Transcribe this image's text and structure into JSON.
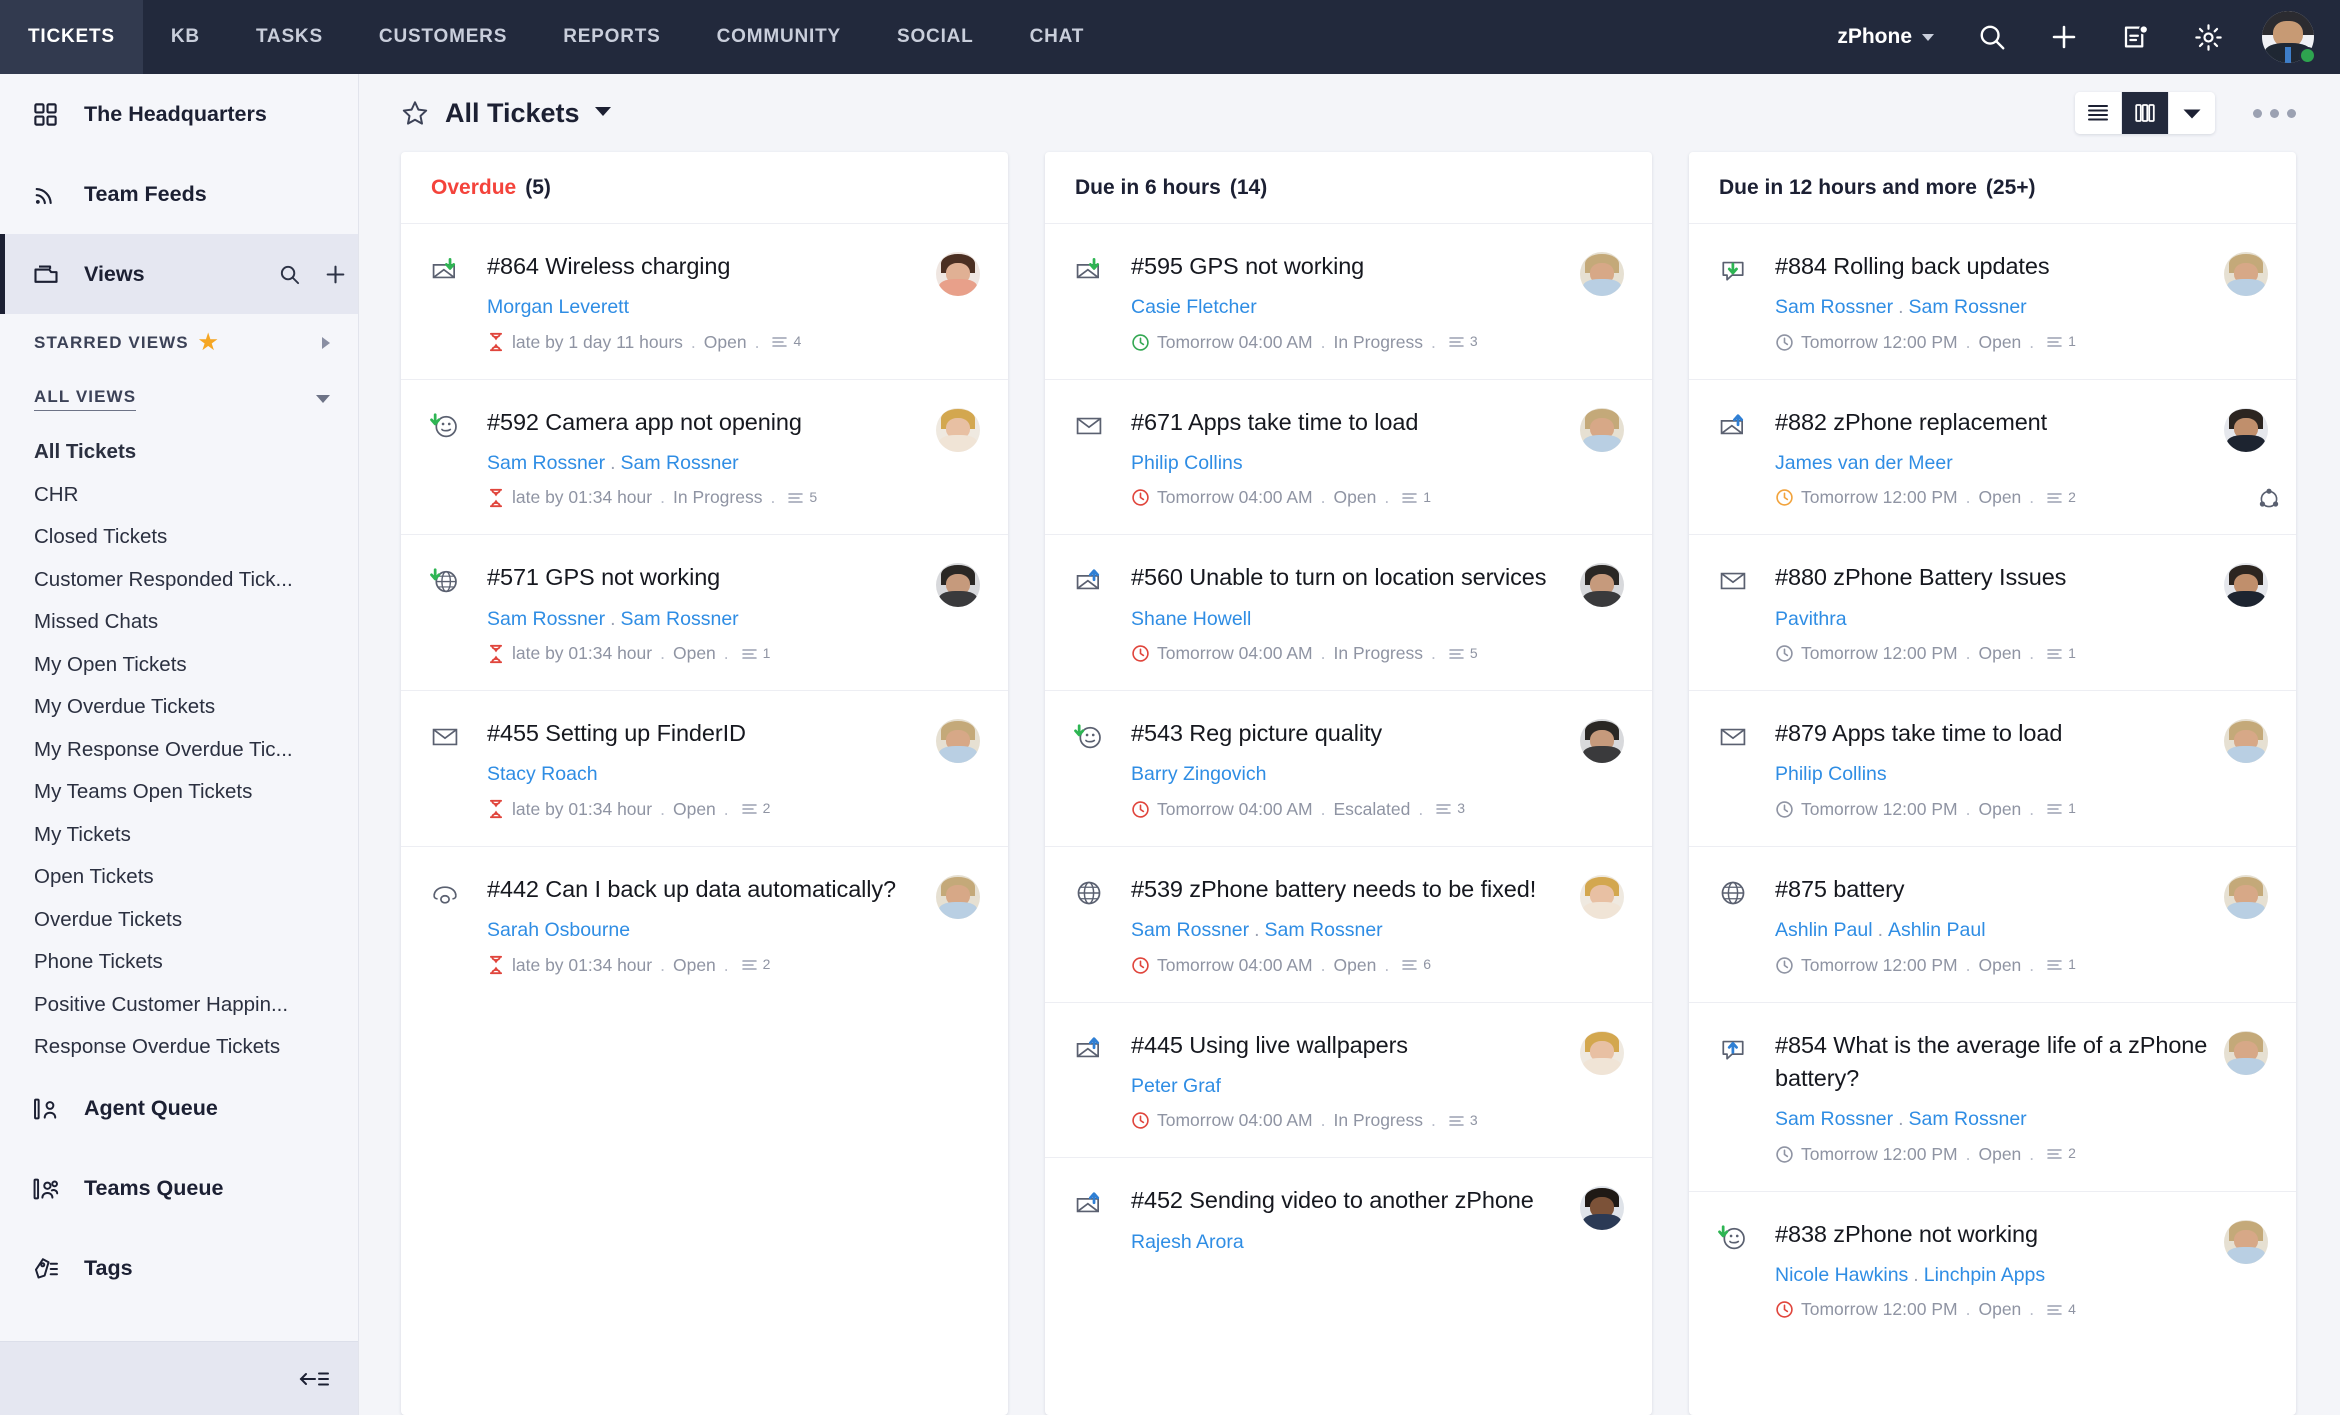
{
  "topnav": {
    "tabs": [
      {
        "label": "TICKETS",
        "active": true
      },
      {
        "label": "KB",
        "active": false
      },
      {
        "label": "TASKS",
        "active": false
      },
      {
        "label": "CUSTOMERS",
        "active": false
      },
      {
        "label": "REPORTS",
        "active": false
      },
      {
        "label": "COMMUNITY",
        "active": false
      },
      {
        "label": "SOCIAL",
        "active": false
      },
      {
        "label": "CHAT",
        "active": false
      }
    ],
    "product": "zPhone",
    "icons": [
      "search-icon",
      "add-icon",
      "notes-icon",
      "gear-icon"
    ],
    "background": "#22293c",
    "active_tab_background": "#323a4f"
  },
  "sidebar": {
    "top_items": [
      {
        "label": "The Headquarters",
        "icon": "grid-icon"
      },
      {
        "label": "Team Feeds",
        "icon": "rss-icon"
      },
      {
        "label": "Views",
        "icon": "views-folder-icon",
        "selected": true
      }
    ],
    "starred_group": "STARRED VIEWS",
    "all_group": "ALL VIEWS",
    "views": [
      {
        "label": "All Tickets",
        "current": true
      },
      {
        "label": "CHR",
        "current": false
      },
      {
        "label": "Closed Tickets",
        "current": false
      },
      {
        "label": "Customer Responded Tick...",
        "current": false
      },
      {
        "label": "Missed Chats",
        "current": false
      },
      {
        "label": "My Open Tickets",
        "current": false
      },
      {
        "label": "My Overdue Tickets",
        "current": false
      },
      {
        "label": "My Response Overdue Tic...",
        "current": false
      },
      {
        "label": "My Teams Open Tickets",
        "current": false
      },
      {
        "label": "My Tickets",
        "current": false
      },
      {
        "label": "Open Tickets",
        "current": false
      },
      {
        "label": "Overdue Tickets",
        "current": false
      },
      {
        "label": "Phone Tickets",
        "current": false
      },
      {
        "label": "Positive Customer Happin...",
        "current": false
      },
      {
        "label": "Response Overdue Tickets",
        "current": false
      }
    ],
    "bottom_items": [
      {
        "label": "Agent Queue",
        "icon": "agent-queue-icon"
      },
      {
        "label": "Teams Queue",
        "icon": "teams-queue-icon"
      },
      {
        "label": "Tags",
        "icon": "tag-icon"
      }
    ],
    "collapse_label": "collapse-sidebar"
  },
  "toolbar": {
    "title": "All Tickets",
    "star_icon": "star-outline-icon",
    "dropdown_icon": "chevron-down-icon",
    "view_list_icon": "list-view-icon",
    "view_kanban_icon": "kanban-view-icon",
    "view_more_icon": "chevron-down-icon",
    "overflow_icon": "more-options-icon"
  },
  "board": {
    "columns": [
      {
        "title": "Overdue",
        "count": "(5)",
        "title_color": "#f4433b",
        "cards": [
          {
            "channel_icon": "email-reply-icon",
            "title": "#864 Wireless charging",
            "people": [
              "Morgan Leverett"
            ],
            "meta_icon": "hourglass-icon",
            "meta_icon_color": "#e0453c",
            "due": "late by 1 day 11 hours",
            "status": "Open",
            "threads": "4",
            "avatar": "woman-brown-hair"
          },
          {
            "channel_icon": "feedback-smiley-reply-icon",
            "title": "#592 Camera app not opening",
            "people": [
              "Sam Rossner",
              "Sam Rossner"
            ],
            "meta_icon": "hourglass-icon",
            "meta_icon_color": "#e0453c",
            "due": "late by 01:34 hour",
            "status": "In Progress",
            "threads": "5",
            "avatar": "woman-blonde"
          },
          {
            "channel_icon": "web-reply-icon",
            "title": "#571 GPS not working",
            "people": [
              "Sam Rossner",
              "Sam Rossner"
            ],
            "meta_icon": "hourglass-icon",
            "meta_icon_color": "#e0453c",
            "due": "late by 01:34 hour",
            "status": "Open",
            "threads": "1",
            "avatar": "man-dark-glasses"
          },
          {
            "channel_icon": "email-icon",
            "title": "#455 Setting up FinderID",
            "people": [
              "Stacy Roach"
            ],
            "meta_icon": "hourglass-icon",
            "meta_icon_color": "#e0453c",
            "due": "late by 01:34 hour",
            "status": "Open",
            "threads": "2",
            "avatar": "man-light-shirt"
          },
          {
            "channel_icon": "phone-icon",
            "title": "#442 Can I back up data automatically?",
            "people": [
              "Sarah Osbourne"
            ],
            "meta_icon": "hourglass-icon",
            "meta_icon_color": "#e0453c",
            "due": "late by 01:34 hour",
            "status": "Open",
            "threads": "2",
            "avatar": "man-light-shirt"
          }
        ]
      },
      {
        "title": "Due in 6 hours",
        "count": "(14)",
        "title_color": "#1c2033",
        "cards": [
          {
            "channel_icon": "email-reply-icon",
            "title": "#595 GPS not working",
            "people": [
              "Casie Fletcher"
            ],
            "meta_icon": "clock-icon",
            "meta_icon_color": "#34a853",
            "due": "Tomorrow 04:00 AM",
            "status": "In Progress",
            "threads": "3",
            "avatar": "man-light-shirt"
          },
          {
            "channel_icon": "email-icon",
            "title": "#671 Apps take time to load",
            "people": [
              "Philip Collins"
            ],
            "meta_icon": "clock-icon",
            "meta_icon_color": "#e0453c",
            "due": "Tomorrow 04:00 AM",
            "status": "Open",
            "threads": "1",
            "avatar": "man-light-shirt"
          },
          {
            "channel_icon": "email-forward-icon",
            "title": "#560 Unable to turn on location services",
            "people": [
              "Shane Howell"
            ],
            "meta_icon": "clock-icon",
            "meta_icon_color": "#e0453c",
            "due": "Tomorrow 04:00 AM",
            "status": "In Progress",
            "threads": "5",
            "avatar": "man-dark-glasses"
          },
          {
            "channel_icon": "feedback-smiley-reply-icon",
            "title": "#543 Reg picture quality",
            "people": [
              "Barry Zingovich"
            ],
            "meta_icon": "clock-icon",
            "meta_icon_color": "#e0453c",
            "due": "Tomorrow 04:00 AM",
            "status": "Escalated",
            "threads": "3",
            "avatar": "man-dark-glasses"
          },
          {
            "channel_icon": "web-icon",
            "title": "#539 zPhone battery needs to be fixed!",
            "people": [
              "Sam Rossner",
              "Sam Rossner"
            ],
            "meta_icon": "clock-icon",
            "meta_icon_color": "#e0453c",
            "due": "Tomorrow 04:00 AM",
            "status": "Open",
            "threads": "6",
            "avatar": "woman-blonde"
          },
          {
            "channel_icon": "email-forward-icon",
            "title": "#445 Using live wallpapers",
            "people": [
              "Peter Graf"
            ],
            "meta_icon": "clock-icon",
            "meta_icon_color": "#e0453c",
            "due": "Tomorrow 04:00 AM",
            "status": "In Progress",
            "threads": "3",
            "avatar": "woman-blonde"
          },
          {
            "channel_icon": "email-forward-icon",
            "title": "#452 Sending video to another zPhone",
            "people": [
              "Rajesh Arora"
            ],
            "meta_icon": "",
            "meta_icon_color": "",
            "due": "",
            "status": "",
            "threads": "",
            "avatar": "man-dark-suit"
          }
        ]
      },
      {
        "title": "Due in 12 hours and more",
        "count": "(25+)",
        "title_color": "#1c2033",
        "cards": [
          {
            "channel_icon": "chat-reply-icon",
            "title": "#884 Rolling back updates",
            "people": [
              "Sam Rossner",
              "Sam Rossner"
            ],
            "meta_icon": "clock-icon",
            "meta_icon_color": "#8f94a3",
            "due": "Tomorrow 12:00 PM",
            "status": "Open",
            "threads": "1",
            "avatar": "man-light-shirt"
          },
          {
            "channel_icon": "email-forward-icon",
            "title": "#882 zPhone replacement",
            "people": [
              "James van der Meer"
            ],
            "meta_icon": "clock-icon",
            "meta_icon_color": "#f2a33c",
            "due": "Tomorrow 12:00 PM",
            "status": "Open",
            "threads": "2",
            "avatar": "man-suit-tie",
            "avatar_badge": "collaborators-icon"
          },
          {
            "channel_icon": "email-icon",
            "title": "#880 zPhone Battery Issues",
            "people": [
              "Pavithra"
            ],
            "meta_icon": "clock-icon",
            "meta_icon_color": "#8f94a3",
            "due": "Tomorrow 12:00 PM",
            "status": "Open",
            "threads": "1",
            "avatar": "man-suit-tie"
          },
          {
            "channel_icon": "email-icon",
            "title": "#879 Apps take time to load",
            "people": [
              "Philip Collins"
            ],
            "meta_icon": "clock-icon",
            "meta_icon_color": "#8f94a3",
            "due": "Tomorrow 12:00 PM",
            "status": "Open",
            "threads": "1",
            "avatar": "man-light-shirt"
          },
          {
            "channel_icon": "web-icon",
            "title": "#875 battery",
            "people": [
              "Ashlin Paul",
              "Ashlin Paul"
            ],
            "meta_icon": "clock-icon",
            "meta_icon_color": "#8f94a3",
            "due": "Tomorrow 12:00 PM",
            "status": "Open",
            "threads": "1",
            "avatar": "man-light-shirt"
          },
          {
            "channel_icon": "chat-forward-icon",
            "title": "#854 What is the average life of a zPhone battery?",
            "people": [
              "Sam Rossner",
              "Sam Rossner"
            ],
            "meta_icon": "clock-icon",
            "meta_icon_color": "#8f94a3",
            "due": "Tomorrow 12:00 PM",
            "status": "Open",
            "threads": "2",
            "avatar": "man-light-shirt"
          },
          {
            "channel_icon": "feedback-smiley-reply-icon",
            "title": "#838 zPhone not working",
            "people": [
              "Nicole Hawkins",
              "Linchpin Apps"
            ],
            "meta_icon": "clock-icon",
            "meta_icon_color": "#e0453c",
            "due": "Tomorrow 12:00 PM",
            "status": "Open",
            "threads": "4",
            "avatar": "man-light-shirt"
          }
        ]
      }
    ]
  },
  "colors": {
    "overdue": "#f4433b",
    "link": "#2f8de4",
    "nav_bg": "#22293c",
    "page_bg": "#f4f5f9",
    "sidebar_bg": "#f5f6fa",
    "star_gold": "#f5a623"
  }
}
